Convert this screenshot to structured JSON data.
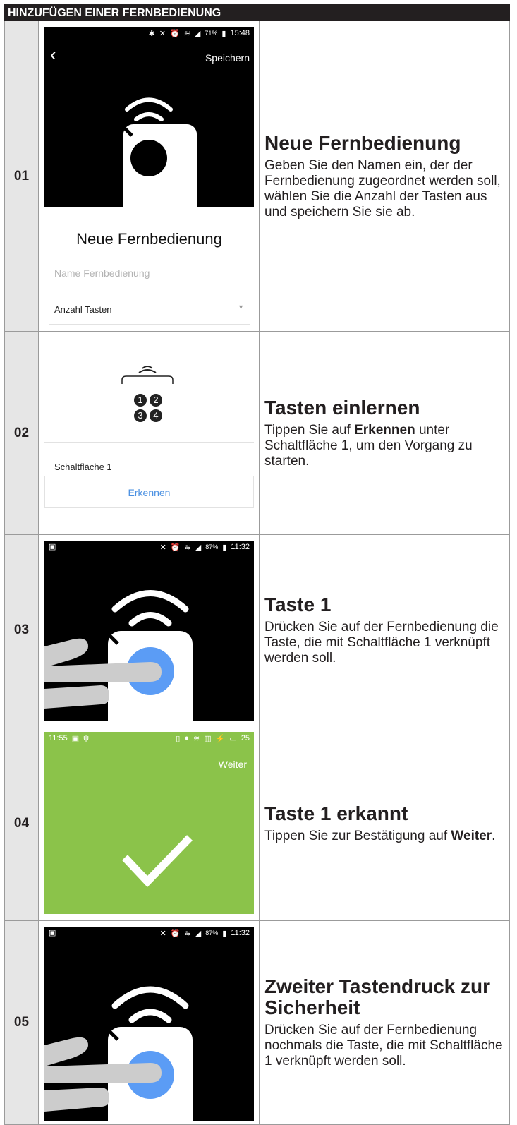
{
  "header": {
    "title": "HINZUFÜGEN EINER FERNBEDIENUNG"
  },
  "steps": [
    {
      "num": "01",
      "title": "Neue Fernbedienung",
      "body": "Geben Sie den Namen ein, der der Fernbedienung zugeordnet werden soll, wählen Sie die Anzahl der Tasten aus und speichern Sie sie ab.",
      "screen": {
        "status_time": "15:48",
        "status_battery": "71%",
        "save_label": "Speichern",
        "heading": "Neue Fernbedienung",
        "name_placeholder": "Name Fernbedienung",
        "keys_label": "Anzahl Tasten"
      }
    },
    {
      "num": "02",
      "title": "Tasten einlernen",
      "body_prefix": "Tippen Sie auf ",
      "body_bold": "Erkennen",
      "body_suffix": " unter Schaltfläche 1, um den Vorgang zu starten.",
      "screen": {
        "keys": [
          "1",
          "2",
          "3",
          "4"
        ],
        "button_label": "Schaltfläche 1",
        "detect_label": "Erkennen"
      }
    },
    {
      "num": "03",
      "title": "Taste 1",
      "body": "Drücken Sie auf der Fernbedienung die Taste, die mit Schaltfläche 1 verknüpft werden soll.",
      "screen": {
        "status_time": "11:32",
        "status_battery": "87%"
      }
    },
    {
      "num": "04",
      "title": "Taste 1 erkannt",
      "body_prefix": "Tippen Sie zur Bestätigung auf ",
      "body_bold": "Weiter",
      "body_suffix": ".",
      "screen": {
        "status_time": "11:55",
        "status_battery": "25",
        "next_label": "Weiter"
      }
    },
    {
      "num": "05",
      "title": "Zweiter Tastendruck zur Sicherheit",
      "body": "Drücken Sie auf der Fernbedienung nochmals die Taste, die mit Schaltfläche 1 verknüpft werden soll.",
      "screen": {
        "status_time": "11:32",
        "status_battery": "87%"
      }
    }
  ],
  "colors": {
    "black": "#000000",
    "green": "#8bc34a",
    "blue": "#5b9cf5",
    "link_blue": "#4a90e2",
    "grey": "#cccccc"
  }
}
